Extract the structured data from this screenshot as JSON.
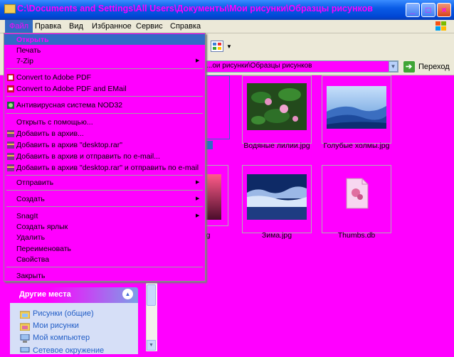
{
  "window": {
    "title": "C:\\Documents and Settings\\All Users\\Документы\\Мои рисунки\\Образцы рисунков",
    "buttons": {
      "minimize": "_",
      "maximize": "□",
      "close": "×"
    }
  },
  "menubar": {
    "items": [
      {
        "label": "Файл"
      },
      {
        "label": "Правка"
      },
      {
        "label": "Вид"
      },
      {
        "label": "Избранное"
      },
      {
        "label": "Сервис"
      },
      {
        "label": "Справка"
      }
    ]
  },
  "address": {
    "path": "...ои рисунки\\Образцы рисунков",
    "go_label": "Переход"
  },
  "file_menu": {
    "items": [
      {
        "label": "Открыть"
      },
      {
        "label": "Печать"
      },
      {
        "label": "7-Zip"
      },
      {
        "label": "Convert to Adobe PDF"
      },
      {
        "label": "Convert to Adobe PDF and EMail"
      },
      {
        "label": "Антивирусная система NOD32"
      },
      {
        "label": "Открыть с помощью..."
      },
      {
        "label": "Добавить в архив..."
      },
      {
        "label": "Добавить в архив \"desktop.rar\""
      },
      {
        "label": "Добавить в архив и отправить по e-mail..."
      },
      {
        "label": "Добавить в архив \"desktop.rar\" и отправить по e-mail"
      },
      {
        "label": "Отправить"
      },
      {
        "label": "Создать"
      },
      {
        "label": "SnagIt"
      },
      {
        "label": "Создать ярлык"
      },
      {
        "label": "Удалить"
      },
      {
        "label": "Переименовать"
      },
      {
        "label": "Свойства"
      },
      {
        "label": "Закрыть"
      }
    ]
  },
  "files": [
    {
      "name": "Водяные лилии.jpg"
    },
    {
      "name": "Голубые холмы.jpg"
    },
    {
      "name": ".jpg"
    },
    {
      "name": "Зима.jpg"
    },
    {
      "name": "Thumbs.db"
    }
  ],
  "other_places": {
    "title": "Другие места",
    "items": [
      {
        "label": "Рисунки (общие)"
      },
      {
        "label": "Мои рисунки"
      },
      {
        "label": "Мой компьютер"
      },
      {
        "label": "Сетевое окружение"
      }
    ]
  },
  "colors": {
    "accent": "#316ac5",
    "background": "#ff00ff",
    "titlebar": "#0a5ce6"
  }
}
